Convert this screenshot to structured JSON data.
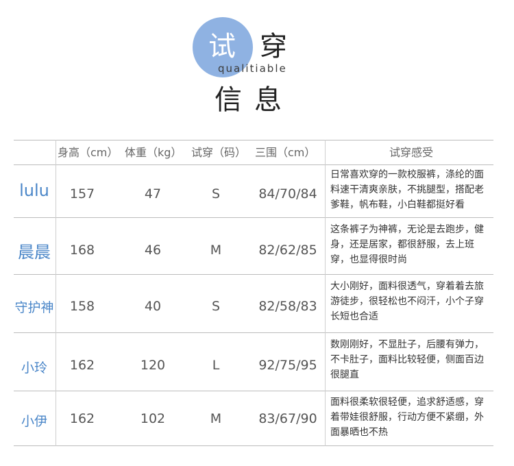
{
  "title": {
    "badge": "试",
    "word": "穿",
    "subtitle": "qualitiable",
    "heading": "信息"
  },
  "header": {
    "height": "身高（cm）",
    "weight": "体重（kg）",
    "size": "试穿（码）",
    "measure": "三围（cm）",
    "feel": "试穿感受"
  },
  "rows": [
    {
      "name": "lulu",
      "height": "157",
      "weight": "47",
      "size": "S",
      "measure": "84/70/84",
      "feel": "日常喜欢穿的一款校服裤，涤纶的面料速干清爽亲肤，不挑腿型，搭配老爹鞋，帆布鞋，小白鞋都挺好看"
    },
    {
      "name": "晨晨",
      "height": "168",
      "weight": "46",
      "size": "M",
      "measure": "82/62/85",
      "feel": "这条裤子为神裤，无论是去跑步，健身，还是居家，都很舒服，去上班穿，也显得很时尚"
    },
    {
      "name": "守护神",
      "height": "158",
      "weight": "40",
      "size": "S",
      "measure": "82/58/83",
      "feel": "大小刚好，面料很透气，穿着着去旅游徒步，很轻松也不闷汗，小个子穿长短也合适"
    },
    {
      "name": "小玲",
      "height": "162",
      "weight": "120",
      "size": "L",
      "measure": "92/75/95",
      "feel": "数刚刚好，不显肚子，后腰有弹力，不卡肚子，面料比较轻便，侧面百边很腿直"
    },
    {
      "name": "小伊",
      "height": "162",
      "weight": "102",
      "size": "M",
      "measure": "83/67/90",
      "feel": "面料很柔软很轻便，追求舒适感，穿着带娃很舒服，行动方便不紧绷，外面暴晒也不热"
    }
  ],
  "colors": {
    "accent": "#8fb2e2",
    "name_text": "#4a86c8"
  }
}
